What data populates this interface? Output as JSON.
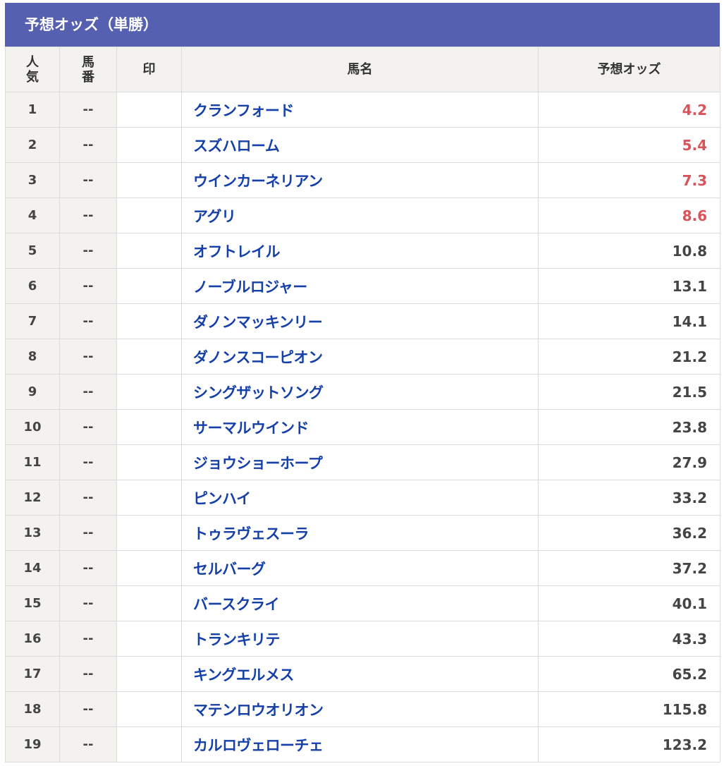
{
  "title": "予想オッズ（単勝）",
  "headers": {
    "rank_line1": "人",
    "rank_line2": "気",
    "num_line1": "馬",
    "num_line2": "番",
    "mark": "印",
    "name": "馬名",
    "odds": "予想オッズ"
  },
  "colors": {
    "header_bar": "#5560b0",
    "horse_link": "#1540a8",
    "hot_odds": "#d9535a"
  },
  "rows": [
    {
      "rank": "1",
      "num": "--",
      "mark": "",
      "name": "クランフォード",
      "odds": "4.2",
      "hot": true
    },
    {
      "rank": "2",
      "num": "--",
      "mark": "",
      "name": "スズハローム",
      "odds": "5.4",
      "hot": true
    },
    {
      "rank": "3",
      "num": "--",
      "mark": "",
      "name": "ウインカーネリアン",
      "odds": "7.3",
      "hot": true
    },
    {
      "rank": "4",
      "num": "--",
      "mark": "",
      "name": "アグリ",
      "odds": "8.6",
      "hot": true
    },
    {
      "rank": "5",
      "num": "--",
      "mark": "",
      "name": "オフトレイル",
      "odds": "10.8",
      "hot": false
    },
    {
      "rank": "6",
      "num": "--",
      "mark": "",
      "name": "ノーブルロジャー",
      "odds": "13.1",
      "hot": false
    },
    {
      "rank": "7",
      "num": "--",
      "mark": "",
      "name": "ダノンマッキンリー",
      "odds": "14.1",
      "hot": false
    },
    {
      "rank": "8",
      "num": "--",
      "mark": "",
      "name": "ダノンスコーピオン",
      "odds": "21.2",
      "hot": false
    },
    {
      "rank": "9",
      "num": "--",
      "mark": "",
      "name": "シングザットソング",
      "odds": "21.5",
      "hot": false
    },
    {
      "rank": "10",
      "num": "--",
      "mark": "",
      "name": "サーマルウインド",
      "odds": "23.8",
      "hot": false
    },
    {
      "rank": "11",
      "num": "--",
      "mark": "",
      "name": "ジョウショーホープ",
      "odds": "27.9",
      "hot": false
    },
    {
      "rank": "12",
      "num": "--",
      "mark": "",
      "name": "ピンハイ",
      "odds": "33.2",
      "hot": false
    },
    {
      "rank": "13",
      "num": "--",
      "mark": "",
      "name": "トゥラヴェスーラ",
      "odds": "36.2",
      "hot": false
    },
    {
      "rank": "14",
      "num": "--",
      "mark": "",
      "name": "セルバーグ",
      "odds": "37.2",
      "hot": false
    },
    {
      "rank": "15",
      "num": "--",
      "mark": "",
      "name": "バースクライ",
      "odds": "40.1",
      "hot": false
    },
    {
      "rank": "16",
      "num": "--",
      "mark": "",
      "name": "トランキリテ",
      "odds": "43.3",
      "hot": false
    },
    {
      "rank": "17",
      "num": "--",
      "mark": "",
      "name": "キングエルメス",
      "odds": "65.2",
      "hot": false
    },
    {
      "rank": "18",
      "num": "--",
      "mark": "",
      "name": "マテンロウオリオン",
      "odds": "115.8",
      "hot": false
    },
    {
      "rank": "19",
      "num": "--",
      "mark": "",
      "name": "カルロヴェローチェ",
      "odds": "123.2",
      "hot": false
    }
  ]
}
